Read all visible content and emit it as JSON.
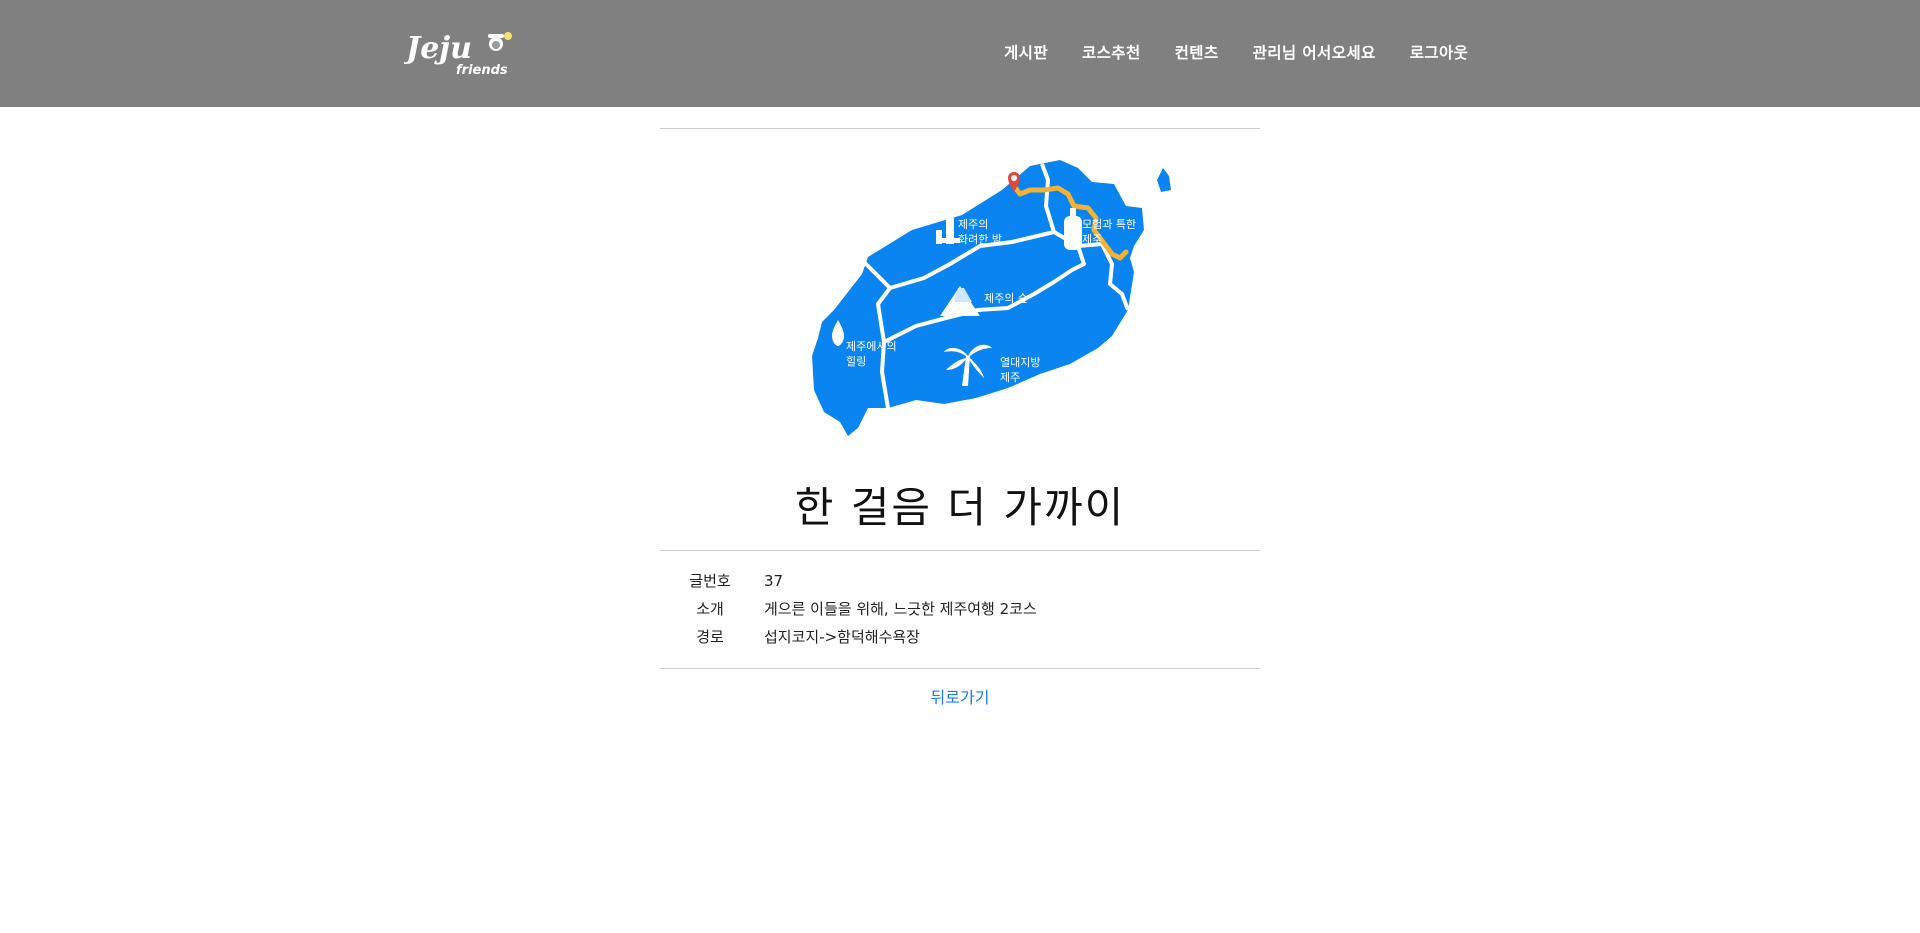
{
  "header": {
    "logo": {
      "primary": "Jeju",
      "secondary": "friends"
    },
    "nav": [
      {
        "label": "게시판"
      },
      {
        "label": "코스추천"
      },
      {
        "label": "컨텐츠"
      },
      {
        "label": "관리님 어서오세요"
      },
      {
        "label": "로그아웃"
      }
    ]
  },
  "map": {
    "regions": [
      {
        "label_lines": [
          "제주의",
          "화려한 밤"
        ]
      },
      {
        "label_lines": [
          "모험과 특한",
          "제주"
        ]
      },
      {
        "label_lines": [
          "제주의 숲"
        ]
      },
      {
        "label_lines": [
          "제주에서의",
          "힐링"
        ]
      },
      {
        "label_lines": [
          "열대지방",
          "제주"
        ]
      }
    ],
    "colors": {
      "land": "#0a84f0",
      "route": "#f2b233",
      "marker": "#e2473b"
    }
  },
  "post": {
    "title": "한 걸음 더 가까이",
    "fields": [
      {
        "label": "글번호",
        "value": "37"
      },
      {
        "label": "소개",
        "value": "게으른 이들을 위해, 느긋한 제주여행 2코스"
      },
      {
        "label": "경로",
        "value": "섭지코지->함덕해수욕장"
      }
    ],
    "back_label": "뒤로가기"
  },
  "colors": {
    "header_bg": "#808080",
    "link": "#1a7ee6"
  }
}
